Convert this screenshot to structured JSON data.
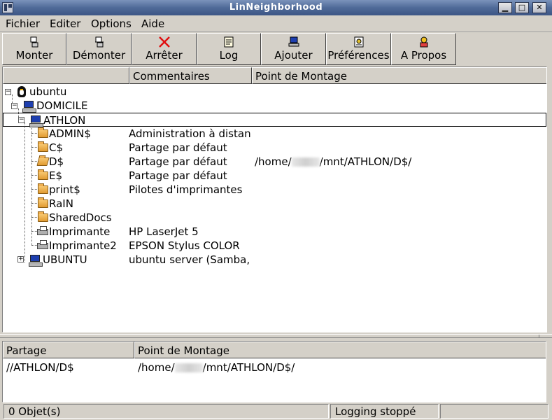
{
  "window": {
    "title": "LinNeighborhood"
  },
  "menu": [
    {
      "label": "Fichier"
    },
    {
      "label": "Editer"
    },
    {
      "label": "Options"
    },
    {
      "label": "Aide"
    }
  ],
  "toolbar": [
    {
      "label": "Monter",
      "icon": "mount-icon"
    },
    {
      "label": "Démonter",
      "icon": "unmount-icon"
    },
    {
      "label": "Arrêter",
      "icon": "stop-icon"
    },
    {
      "label": "Log",
      "icon": "log-icon"
    },
    {
      "label": "Ajouter",
      "icon": "add-icon"
    },
    {
      "label": "Préférences",
      "icon": "preferences-icon"
    },
    {
      "label": "A Propos",
      "icon": "about-icon"
    }
  ],
  "browser": {
    "columns": [
      "",
      "Commentaires",
      "Point de Montage"
    ],
    "root": {
      "label": "ubuntu"
    },
    "workgroup": {
      "label": "DOMICILE"
    },
    "host": {
      "label": "ATHLON"
    },
    "shares": [
      {
        "name": "ADMIN$",
        "comment": "Administration à distanc",
        "mount": "",
        "icon": "folder"
      },
      {
        "name": "C$",
        "comment": "Partage par défaut",
        "mount": "",
        "icon": "folder"
      },
      {
        "name": "D$",
        "comment": "Partage par défaut",
        "mount_prefix": "/home/",
        "mount_suffix": "/mnt/ATHLON/D$/",
        "icon": "folder-open"
      },
      {
        "name": "E$",
        "comment": "Partage par défaut",
        "mount": "",
        "icon": "folder"
      },
      {
        "name": "print$",
        "comment": "Pilotes d'imprimantes",
        "mount": "",
        "icon": "folder"
      },
      {
        "name": "RaIN",
        "comment": "",
        "mount": "",
        "icon": "folder"
      },
      {
        "name": "SharedDocs",
        "comment": "",
        "mount": "",
        "icon": "folder"
      },
      {
        "name": "Imprimante",
        "comment": "HP LaserJet 5",
        "mount": "",
        "icon": "printer"
      },
      {
        "name": "Imprimante2",
        "comment": "EPSON Stylus COLOR",
        "mount": "",
        "icon": "printer"
      }
    ],
    "host2": {
      "label": "UBUNTU",
      "comment": "ubuntu server (Samba,"
    }
  },
  "mounts": {
    "columns": [
      "Partage",
      "Point de Montage"
    ],
    "rows": [
      {
        "share": "//ATHLON/D$",
        "mount_prefix": "/home/",
        "mount_suffix": "/mnt/ATHLON/D$/"
      }
    ]
  },
  "status": {
    "objects": "0 Objet(s)",
    "logging": "Logging stoppé"
  },
  "colors": {
    "titlebar": "#4f6a98",
    "window_bg": "#d4d0c8"
  }
}
